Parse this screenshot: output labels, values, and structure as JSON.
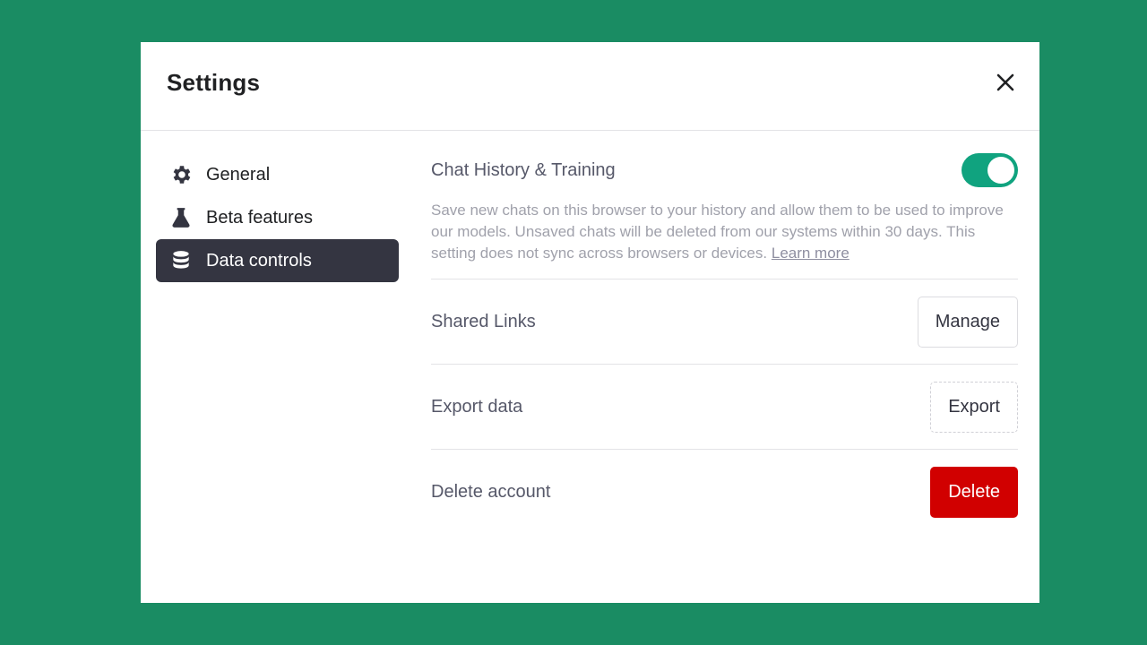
{
  "modal": {
    "title": "Settings",
    "close_icon": "close-icon"
  },
  "sidebar": {
    "items": [
      {
        "label": "General",
        "icon": "gear-icon",
        "active": false
      },
      {
        "label": "Beta features",
        "icon": "flask-icon",
        "active": false
      },
      {
        "label": "Data controls",
        "icon": "database-icon",
        "active": true
      }
    ]
  },
  "content": {
    "chat_history": {
      "title": "Chat History & Training",
      "enabled": true,
      "description": "Save new chats on this browser to your history and allow them to be used to improve our models. Unsaved chats will be deleted from our systems within 30 days. This setting does not sync across browsers or devices.",
      "learn_more": "Learn more"
    },
    "shared_links": {
      "label": "Shared Links",
      "button": "Manage"
    },
    "export_data": {
      "label": "Export data",
      "button": "Export"
    },
    "delete_account": {
      "label": "Delete account",
      "button": "Delete"
    }
  },
  "colors": {
    "background": "#1a8c63",
    "toggle_on": "#10a37f",
    "active_nav": "#343541",
    "danger": "#d10000"
  }
}
